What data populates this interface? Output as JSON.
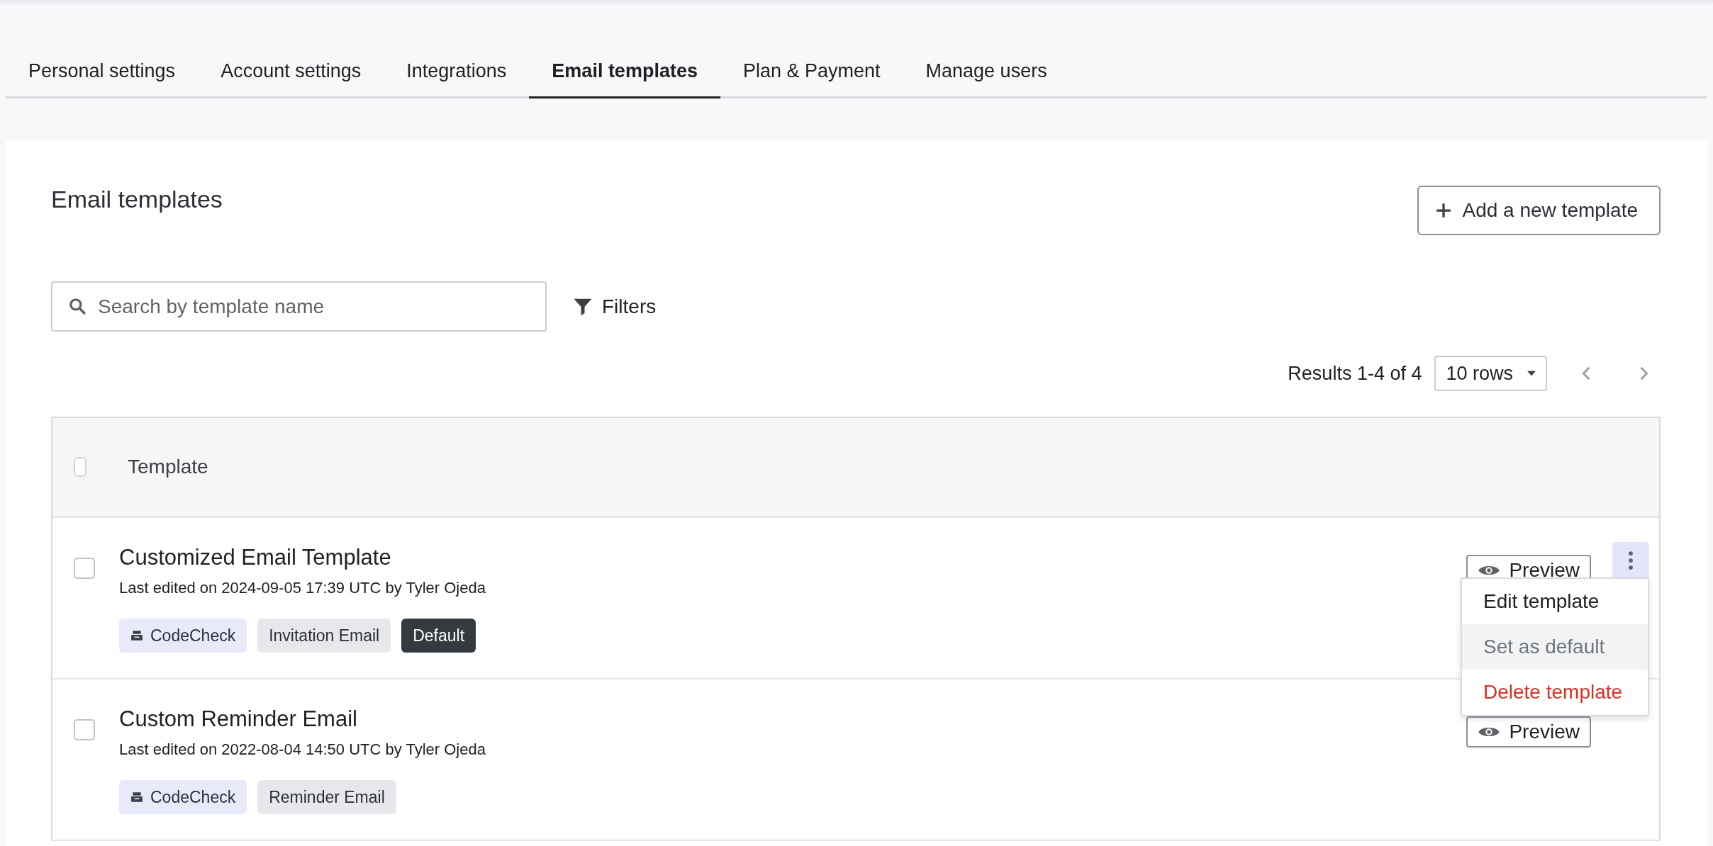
{
  "tabs": [
    {
      "label": "Personal settings",
      "selected": false
    },
    {
      "label": "Account settings",
      "selected": false
    },
    {
      "label": "Integrations",
      "selected": false
    },
    {
      "label": "Email templates",
      "selected": true
    },
    {
      "label": "Plan & Payment",
      "selected": false
    },
    {
      "label": "Manage users",
      "selected": false
    }
  ],
  "page": {
    "title": "Email templates",
    "add_button": "Add a new template"
  },
  "search": {
    "placeholder": "Search by template name"
  },
  "filters": "Filters",
  "pagination": {
    "results": "Results 1-4 of 4",
    "rows": "10 rows"
  },
  "table": {
    "columns": [
      "Template"
    ],
    "select_all_checked": false,
    "rows": [
      {
        "title": "Customized Email Template",
        "meta": "Last edited on 2024-09-05 17:39 UTC by Tyler Ojeda",
        "checked": false,
        "preview": "Preview",
        "menu_open": true,
        "tags": [
          {
            "label": "CodeCheck",
            "kind": "product"
          },
          {
            "label": "Invitation Email",
            "kind": "type"
          },
          {
            "label": "Default",
            "kind": "default"
          }
        ]
      },
      {
        "title": "Custom Reminder Email",
        "meta": "Last edited on 2022-08-04 14:50 UTC by Tyler Ojeda",
        "checked": false,
        "preview": "Preview",
        "menu_open": false,
        "tags": [
          {
            "label": "CodeCheck",
            "kind": "product"
          },
          {
            "label": "Reminder Email",
            "kind": "type"
          }
        ]
      }
    ]
  },
  "menu": [
    {
      "label": "Edit template",
      "kind": "normal",
      "disabled": false
    },
    {
      "label": "Set as default",
      "kind": "normal",
      "disabled": true
    },
    {
      "label": "Delete template",
      "kind": "danger",
      "disabled": false
    }
  ]
}
